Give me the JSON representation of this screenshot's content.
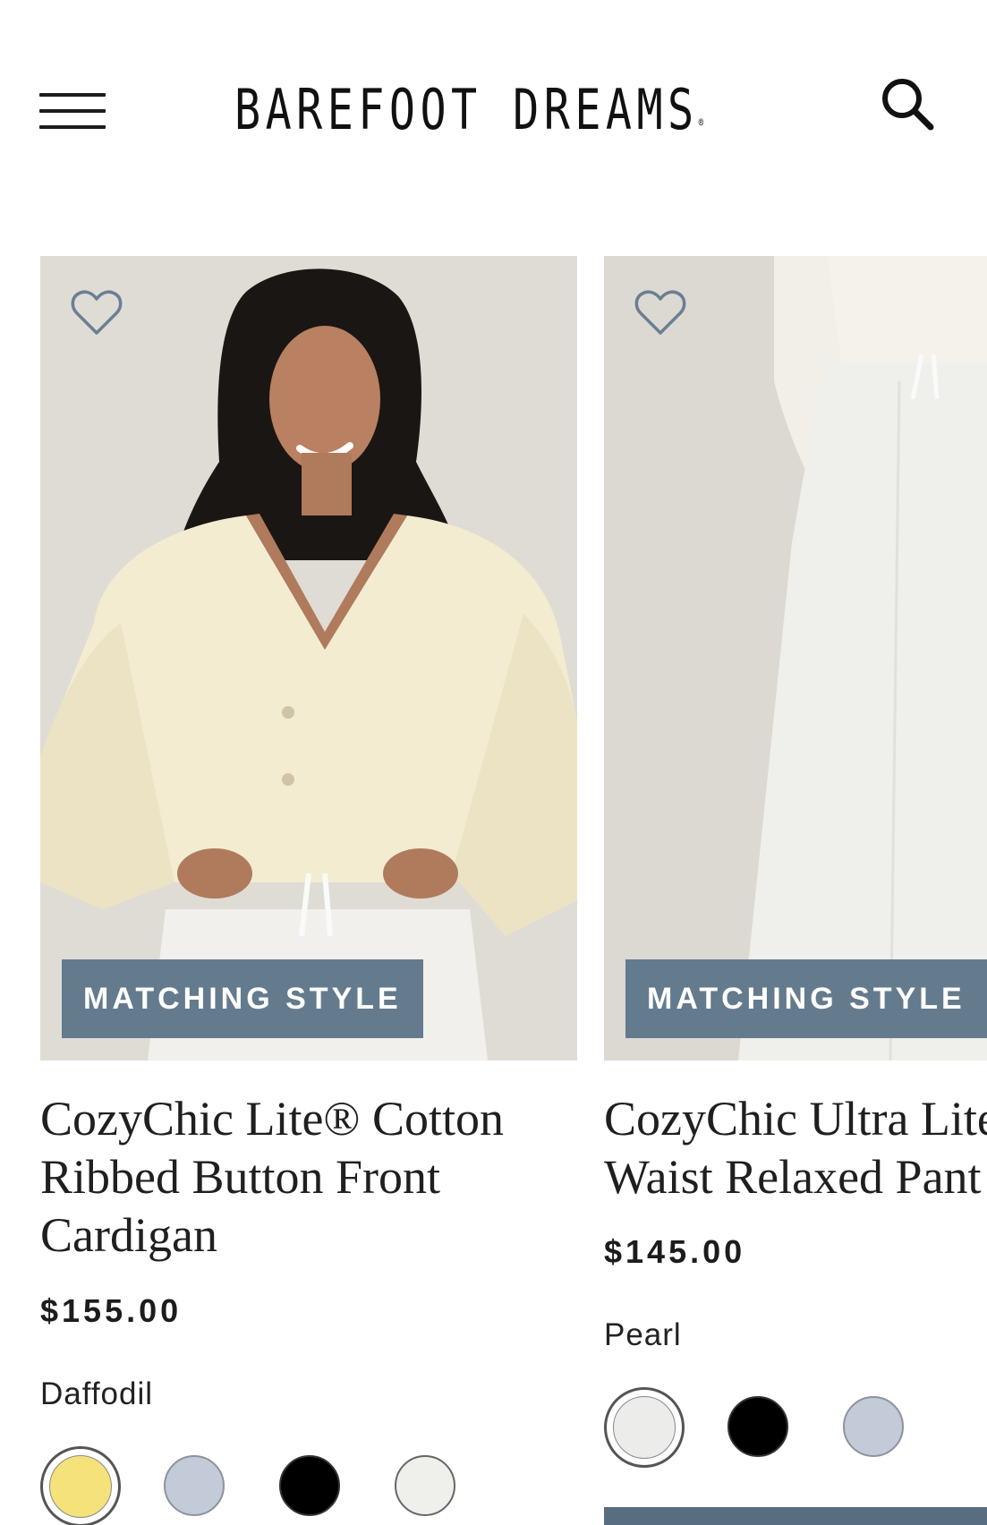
{
  "brand": {
    "logo_text": "BAREFOOT DREAMS",
    "registered_mark": "®"
  },
  "header": {
    "menu_icon": "hamburger-menu-icon",
    "search_icon": "search-icon"
  },
  "colors": {
    "badge": "#647b8d",
    "text": "#1c1c1c",
    "image_bg": "#e0ddd7"
  },
  "products": [
    {
      "badge": "MATCHING STYLE",
      "title": "CozyChic Lite® Cotton\nRibbed Button Front\nCardigan",
      "price": "$155.00",
      "selected_color": "Daffodil",
      "swatches": [
        {
          "color": "#f5e27a",
          "selected": true
        },
        {
          "color": "#c4cbd8",
          "selected": false
        },
        {
          "color": "#000000",
          "selected": false
        },
        {
          "color": "#efefec",
          "selected": false
        }
      ]
    },
    {
      "badge": "MATCHING STYLE",
      "title": "CozyChic Ultra Lite®\nWaist Relaxed Pant",
      "price": "$145.00",
      "selected_color": "Pearl",
      "swatches": [
        {
          "color": "#ececea",
          "selected": true
        },
        {
          "color": "#000000",
          "selected": false
        },
        {
          "color": "#c4cbd8",
          "selected": false
        }
      ]
    }
  ]
}
